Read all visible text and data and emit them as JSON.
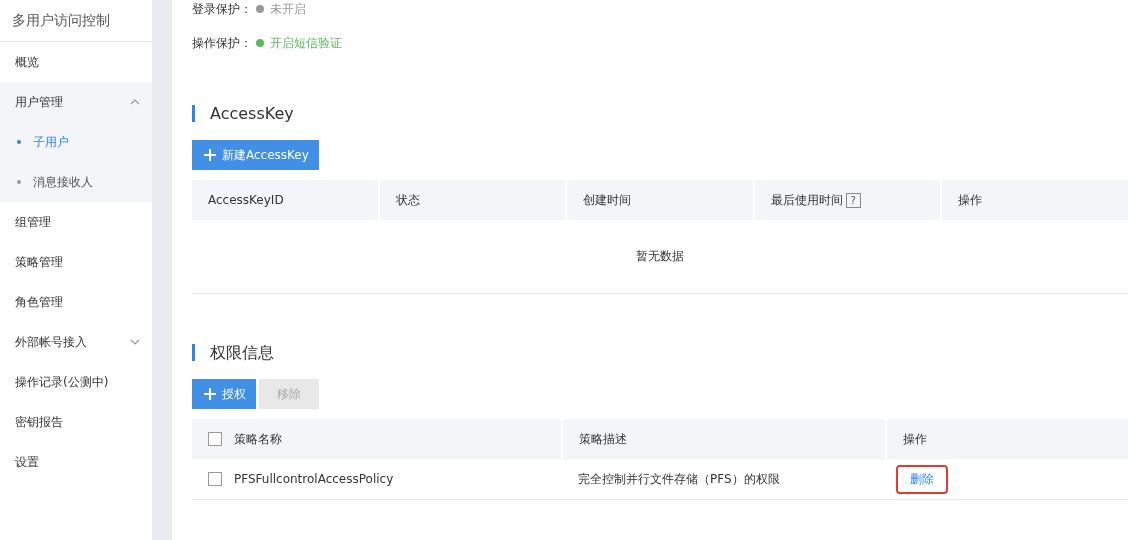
{
  "sidebar": {
    "title": "多用户访问控制",
    "items": [
      {
        "label": "概览",
        "selected": false
      },
      {
        "label": "用户管理",
        "selected": false,
        "expanded": true,
        "children": [
          {
            "label": "子用户",
            "selected": true
          },
          {
            "label": "消息接收人",
            "selected": false
          }
        ]
      },
      {
        "label": "组管理",
        "selected": false
      },
      {
        "label": "策略管理",
        "selected": false
      },
      {
        "label": "角色管理",
        "selected": false
      },
      {
        "label": "外部帐号接入",
        "selected": false,
        "expanded": false
      },
      {
        "label": "操作记录(公测中)",
        "selected": false
      },
      {
        "label": "密钥报告",
        "selected": false
      },
      {
        "label": "设置",
        "selected": false
      }
    ]
  },
  "protection": [
    {
      "label": "登录保护：",
      "value": "未开启",
      "color": "#999999"
    },
    {
      "label": "操作保护：",
      "value": "开启短信验证",
      "color": "#5cb85c"
    }
  ],
  "access_key": {
    "title": "AccessKey",
    "create_button": "新建AccessKey",
    "columns": [
      {
        "label": "AccessKeyID"
      },
      {
        "label": "状态"
      },
      {
        "label": "创建时间"
      },
      {
        "label": "最后使用时间",
        "help": "?"
      },
      {
        "label": "操作"
      }
    ],
    "empty_text": "暂无数据"
  },
  "permissions": {
    "title": "权限信息",
    "buttons": [
      {
        "label": "授权",
        "disabled": false
      },
      {
        "label": "移除",
        "disabled": true
      }
    ],
    "columns": [
      {
        "label": "策略名称"
      },
      {
        "label": "策略描述"
      },
      {
        "label": "操作"
      }
    ],
    "header_checked": false,
    "rows": [
      {
        "checked": false,
        "name": "PFSFullcontrolAccessPolicy",
        "description": "完全控制并行文件存储（PFS）的权限",
        "action": "删除",
        "highlighted": true
      }
    ]
  }
}
